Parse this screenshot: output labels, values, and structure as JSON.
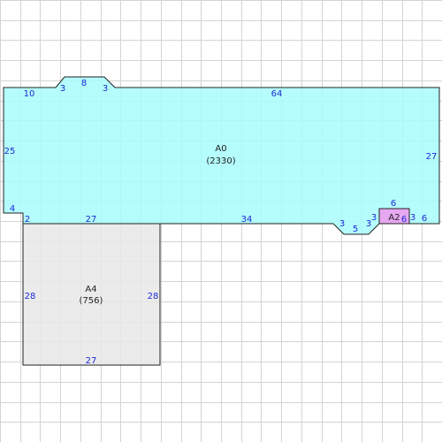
{
  "colors": {
    "grid": "#d4d4d4",
    "outline": "#222222",
    "dimension_text": "#1c2bd8",
    "label_text": "#222222",
    "room_A0_fill": "#a8fbfb",
    "room_A4_fill": "#e8e8e8",
    "room_A2_fill": "#ee99ee"
  },
  "rooms": [
    {
      "key": "A0",
      "name": "A0",
      "area": "(2330)"
    },
    {
      "key": "A4",
      "name": "A4",
      "area": "(756)"
    },
    {
      "key": "A2",
      "name": "A2",
      "area": ""
    }
  ],
  "dimensions": [
    {
      "key": "A0-top-left",
      "value": "10"
    },
    {
      "key": "A0-bump-left",
      "value": "3"
    },
    {
      "key": "A0-bump-top",
      "value": "8"
    },
    {
      "key": "A0-bump-right",
      "value": "3"
    },
    {
      "key": "A0-top",
      "value": "64"
    },
    {
      "key": "A0-left",
      "value": "25"
    },
    {
      "key": "A0-right",
      "value": "27"
    },
    {
      "key": "A0-left-step",
      "value": "4"
    },
    {
      "key": "A0-bottom-step",
      "value": "2"
    },
    {
      "key": "A0-bottom-over-A4",
      "value": "27"
    },
    {
      "key": "A0-bottom",
      "value": "34"
    },
    {
      "key": "A0-notch-left",
      "value": "3"
    },
    {
      "key": "A0-notch-bottom",
      "value": "5"
    },
    {
      "key": "A0-notch-right",
      "value": "3"
    },
    {
      "key": "A0-step-right",
      "value": "3"
    },
    {
      "key": "A2-top",
      "value": "6"
    },
    {
      "key": "A2-bottom",
      "value": "6"
    },
    {
      "key": "A2-right",
      "value": "3"
    },
    {
      "key": "A0-bottom-right",
      "value": "6"
    },
    {
      "key": "A4-left",
      "value": "28"
    },
    {
      "key": "A4-right",
      "value": "28"
    },
    {
      "key": "A4-bottom",
      "value": "27"
    }
  ]
}
